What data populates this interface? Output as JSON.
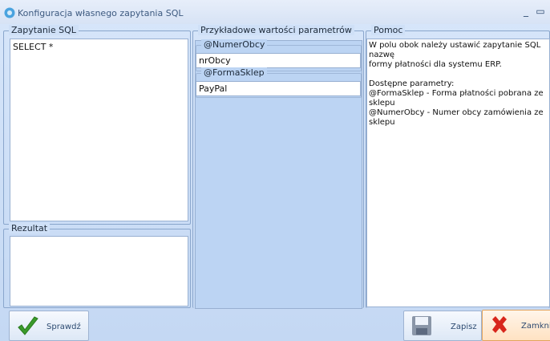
{
  "window": {
    "title": "Konfiguracja własnego zapytania SQL",
    "minimize_glyph": "_",
    "maximize_glyph": "▭"
  },
  "sql_panel": {
    "legend": "Zapytanie SQL",
    "query": "SELECT *"
  },
  "result_panel": {
    "legend": "Rezultat",
    "value": ""
  },
  "params_panel": {
    "legend": "Przykładowe wartości parametrów",
    "params": [
      {
        "name": "@NumerObcy",
        "value": "nrObcy"
      },
      {
        "name": "@FormaSklep",
        "value": "PayPal"
      }
    ]
  },
  "help_panel": {
    "legend": "Pomoc",
    "lines": [
      "W polu obok należy ustawić zapytanie SQL nazwę",
      "formy płatności dla systemu ERP.",
      "",
      "Dostępne parametry:",
      "@FormaSklep - Forma płatności pobrana ze sklepu",
      "@NumerObcy - Numer obcy zamówienia ze sklepu"
    ]
  },
  "buttons": {
    "check": "Sprawdź",
    "save": "Zapisz",
    "close": "Zamknij"
  },
  "colors": {
    "check_icon": "#3a9a2a",
    "close_icon": "#d8261c"
  }
}
